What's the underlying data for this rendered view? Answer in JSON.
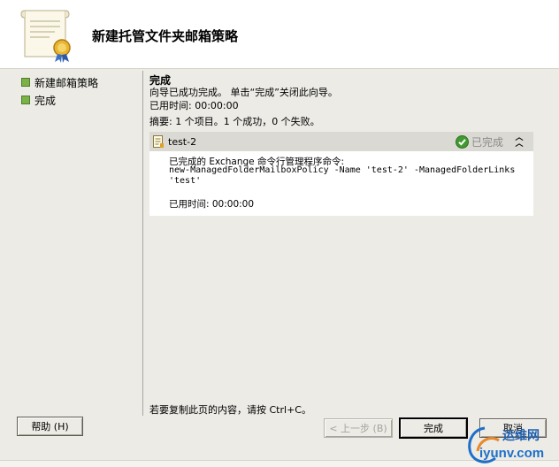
{
  "wizard": {
    "title": "新建托管文件夹邮箱策略"
  },
  "nav": {
    "items": [
      {
        "label": "新建邮箱策略"
      },
      {
        "label": "完成"
      }
    ]
  },
  "main": {
    "heading": "完成",
    "intro": "向导已成功完成。 单击“完成”关闭此向导。",
    "elapsed": "已用时间: 00:00:00",
    "summary": "摘要: 1 个项目。1 个成功，0 个失败。",
    "task": {
      "name": "test-2",
      "status": "已完成",
      "lines": {
        "completed": "已完成的 Exchange 命令行管理程序命令:",
        "command1": "new-ManagedFolderMailboxPolicy -Name 'test-2' -ManagedFolderLinks",
        "command2": "'test'",
        "elapsed": "已用时间: 00:00:00"
      }
    },
    "copy_hint": "若要复制此页的内容，请按 Ctrl+C。"
  },
  "buttons": {
    "help": "帮助 (H)",
    "back": "< 上一步 (B)",
    "finish": "完成",
    "cancel": "取消"
  },
  "watermark": {
    "line1": "运维网",
    "line2": "iyunv.com"
  },
  "colors": {
    "accent_green": "#7bb247",
    "watermark_blue": "#1f6fc9"
  }
}
